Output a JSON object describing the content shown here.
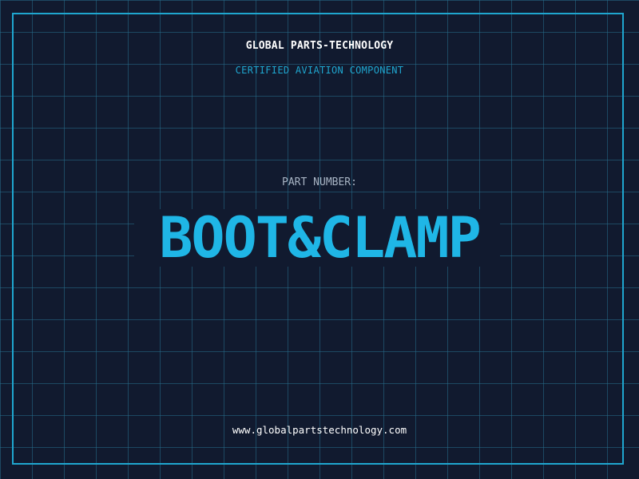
{
  "header": {
    "company": "GLOBAL PARTS-TECHNOLOGY",
    "subtitle": "CERTIFIED AVIATION COMPONENT"
  },
  "part": {
    "label": "PART NUMBER:",
    "number": "BOOT&CLAMP"
  },
  "footer": {
    "url": "www.globalpartstechnology.com"
  },
  "colors": {
    "background": "#111a2f",
    "grid": "#266e8c",
    "accent": "#1fa6cf",
    "part_number": "#1fb6e6",
    "text": "#ffffff",
    "label": "#a8b4c4"
  }
}
